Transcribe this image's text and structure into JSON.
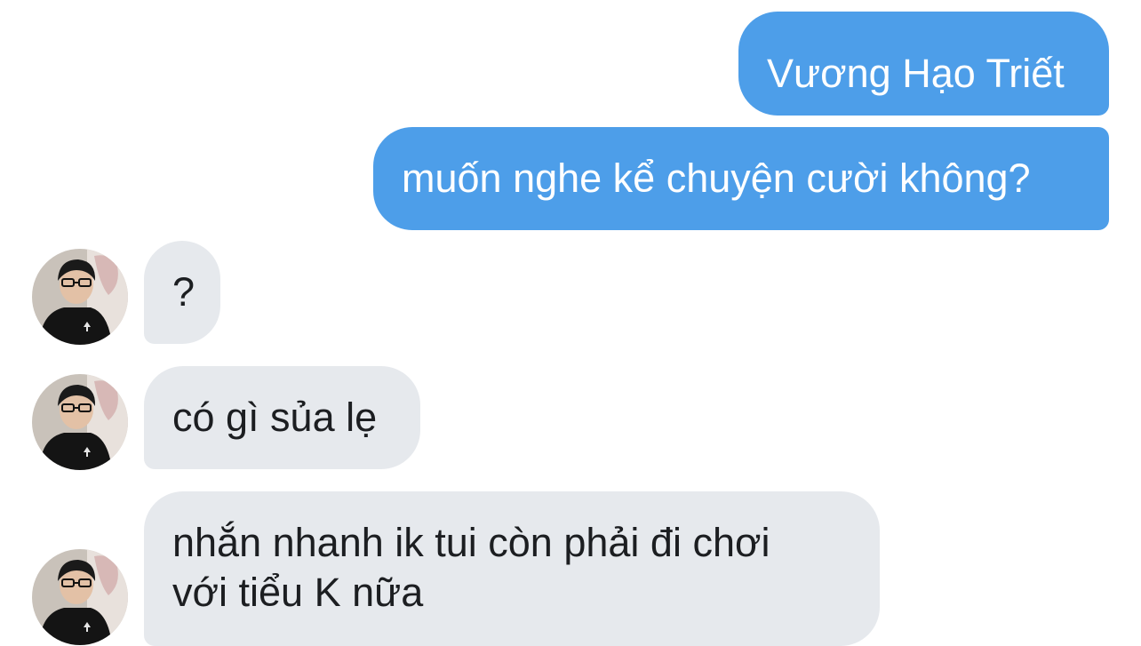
{
  "messages": [
    {
      "side": "outgoing",
      "text": "Vương Hạo Triết"
    },
    {
      "side": "outgoing",
      "text": "muốn nghe kể chuyện cười không?"
    },
    {
      "side": "incoming",
      "text": "?"
    },
    {
      "side": "incoming",
      "text": "có gì sủa lẹ"
    },
    {
      "side": "incoming",
      "lines": [
        "nhắn nhanh ik tui còn phải đi chơi",
        "với tiểu K nữa"
      ]
    }
  ],
  "colors": {
    "outgoing_bubble": "#4d9ee9",
    "incoming_bubble": "#e6e9ed",
    "outgoing_text": "#ffffff",
    "incoming_text": "#1c1e21"
  },
  "icons": {
    "avatar": "user-avatar-photo"
  }
}
